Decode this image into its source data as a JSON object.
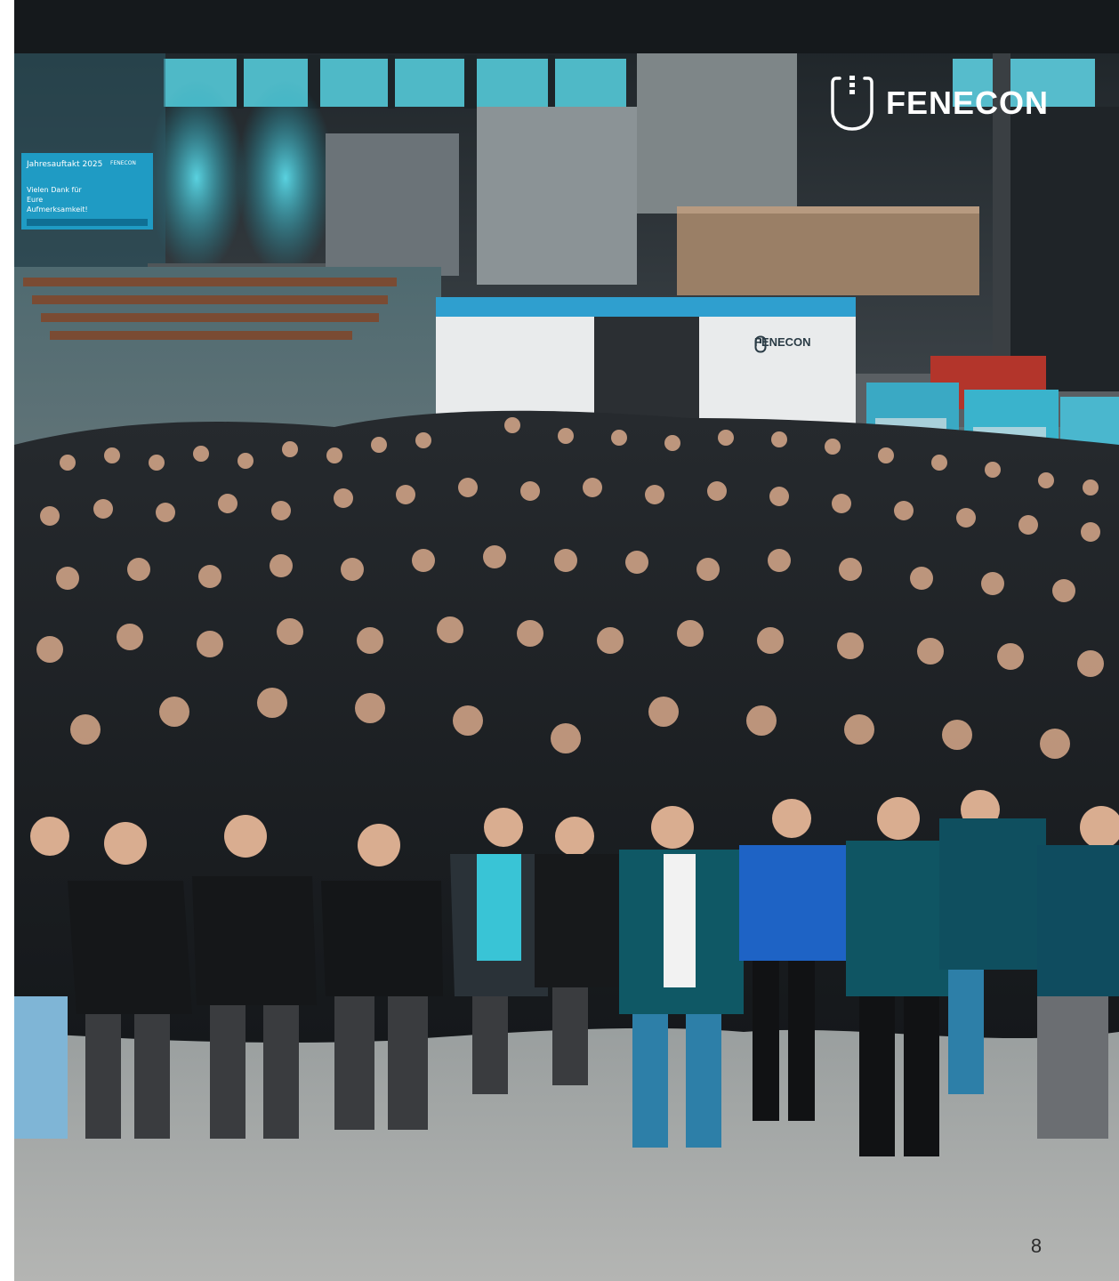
{
  "logo": {
    "text": "FENECON",
    "icon": "fenecon-logo-icon"
  },
  "photo": {
    "screen_title": "Jahresauftakt 2025",
    "screen_brand": "FENECON",
    "screen_message": "Vielen Dank für Eure Aufmerksamkeit!",
    "unit_brand": "FENECON"
  },
  "page_number": "8",
  "colors": {
    "floor": "#a9aaa9",
    "teal_accent": "#3cc3d6",
    "logo_white": "#ffffff"
  }
}
